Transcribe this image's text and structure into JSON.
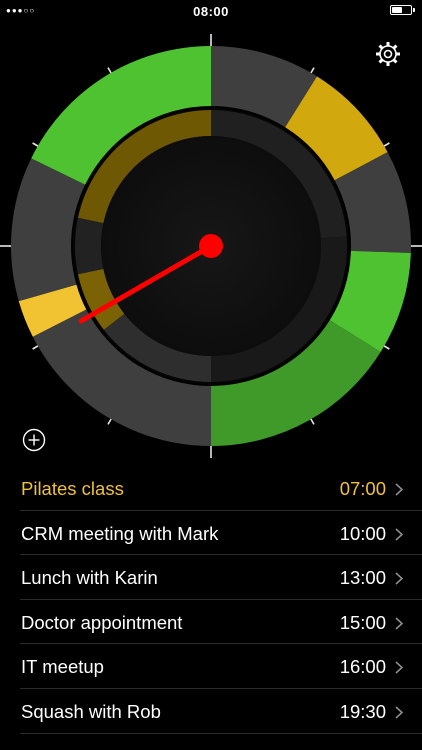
{
  "status_bar": {
    "time": "08:00",
    "signal": "●●●○○",
    "battery_level": 0.55
  },
  "colors": {
    "accent_yellow": "#f1c232",
    "green": "#4ec230",
    "dark_green": "#3f9a2a",
    "gold": "#d1a80d",
    "gray": "#3f3f3f",
    "hand_red": "#ff0000"
  },
  "clock": {
    "current_time_hours": 8.0,
    "hand_angle_hours": 8.0
  },
  "icons": {
    "settings": "gear-icon",
    "add": "plus-circle-icon",
    "row_disclosure": "chevron-right-icon"
  },
  "events": [
    {
      "title": "Pilates class",
      "time": "07:00",
      "highlight": true
    },
    {
      "title": "CRM meeting with Mark",
      "time": "10:00",
      "highlight": false
    },
    {
      "title": "Lunch with Karin",
      "time": "13:00",
      "highlight": false
    },
    {
      "title": "Doctor appointment",
      "time": "15:00",
      "highlight": false
    },
    {
      "title": "IT meetup",
      "time": "16:00",
      "highlight": false
    },
    {
      "title": "Squash with Rob",
      "time": "19:30",
      "highlight": false
    }
  ]
}
